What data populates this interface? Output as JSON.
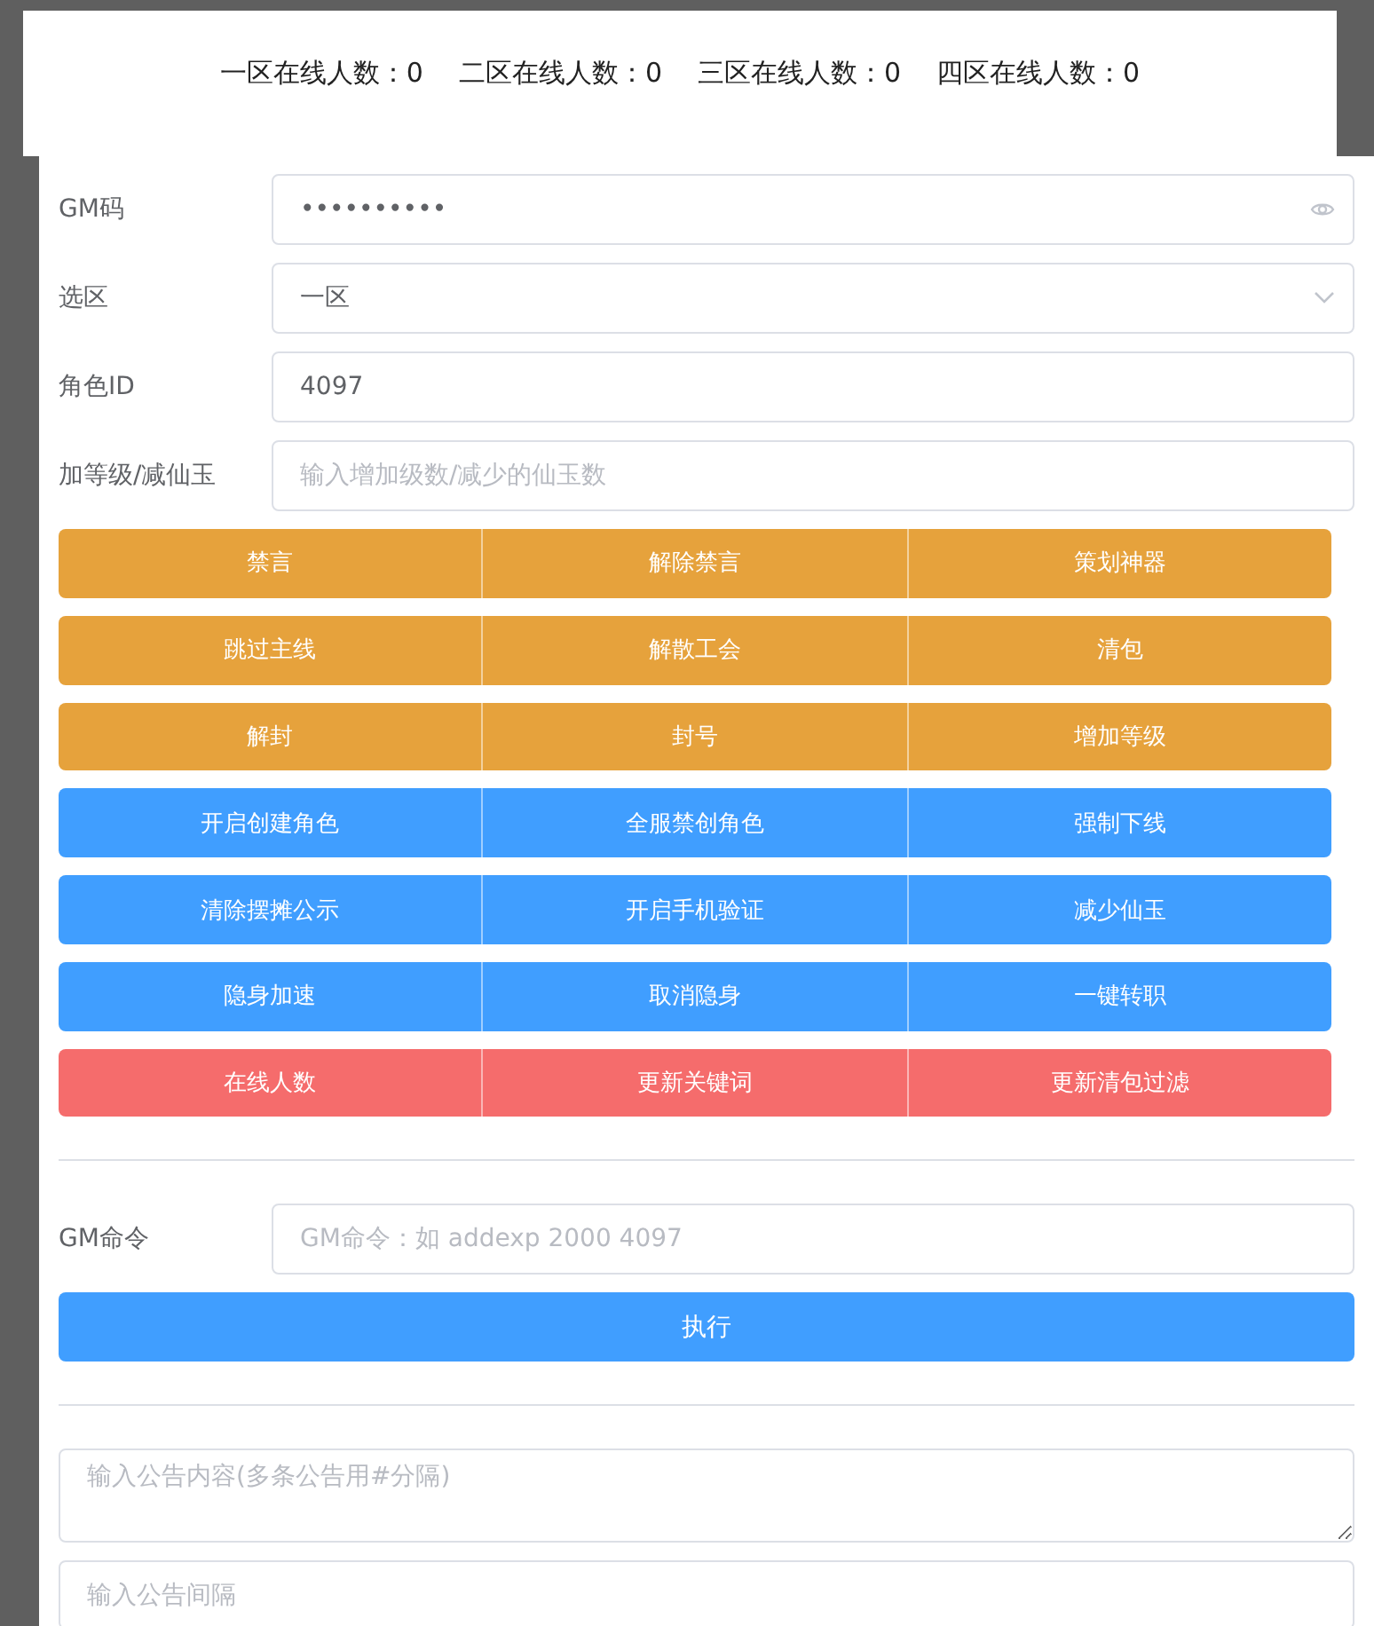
{
  "online_counts": [
    "一区在线人数：0",
    "二区在线人数：0",
    "三区在线人数：0",
    "四区在线人数：0"
  ],
  "form": [
    {
      "label": "GM码",
      "kind": "password",
      "value": "••••••••••"
    },
    {
      "label": "选区",
      "kind": "select",
      "value": "一区"
    },
    {
      "label": "角色ID",
      "kind": "text",
      "value": "4097"
    },
    {
      "label": "加等级/减仙玉",
      "kind": "text",
      "placeholder": "输入增加级数/减少的仙玉数"
    }
  ],
  "button_groups": [
    {
      "kind": "warning",
      "buttons": [
        "禁言",
        "解除禁言",
        "策划神器"
      ]
    },
    {
      "kind": "warning",
      "buttons": [
        "跳过主线",
        "解散工会",
        "清包"
      ]
    },
    {
      "kind": "warning",
      "buttons": [
        "解封",
        "封号",
        "增加等级"
      ]
    },
    {
      "kind": "primary",
      "buttons": [
        "开启创建角色",
        "全服禁创角色",
        "强制下线"
      ]
    },
    {
      "kind": "primary",
      "buttons": [
        "清除摆摊公示",
        "开启手机验证",
        "减少仙玉"
      ]
    },
    {
      "kind": "primary",
      "buttons": [
        "隐身加速",
        "取消隐身",
        "一键转职"
      ]
    },
    {
      "kind": "danger",
      "buttons": [
        "在线人数",
        "更新关键词",
        "更新清包过滤"
      ]
    }
  ],
  "gm_command": {
    "label": "GM命令",
    "placeholder": "GM命令：如 addexp 2000 4097",
    "button": "执行"
  },
  "notice": {
    "content_placeholder": "输入公告内容(多条公告用#分隔)",
    "interval_placeholder": "输入公告间隔"
  }
}
